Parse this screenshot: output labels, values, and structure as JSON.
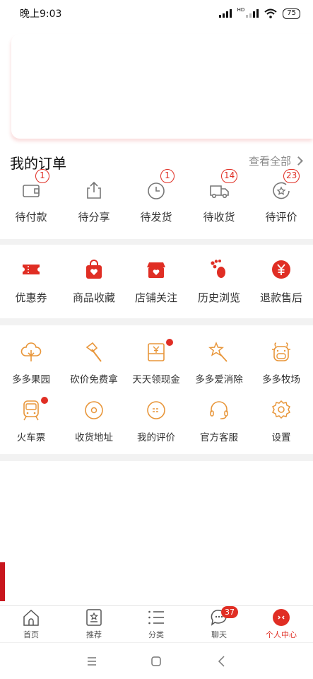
{
  "status_bar": {
    "time": "晚上9:03",
    "battery": "75",
    "network_tag": "HD"
  },
  "orders": {
    "title": "我的订单",
    "view_all": "查看全部",
    "items": [
      {
        "label": "待付款",
        "badge": "1",
        "icon": "wallet-icon"
      },
      {
        "label": "待分享",
        "badge": "",
        "icon": "share-icon"
      },
      {
        "label": "待发货",
        "badge": "1",
        "icon": "clock-icon"
      },
      {
        "label": "待收货",
        "badge": "14",
        "icon": "truck-icon"
      },
      {
        "label": "待评价",
        "badge": "23",
        "icon": "review-icon"
      }
    ]
  },
  "services": {
    "items": [
      {
        "label": "优惠券",
        "icon": "coupon-icon"
      },
      {
        "label": "商品收藏",
        "icon": "favorite-bag-icon"
      },
      {
        "label": "店铺关注",
        "icon": "store-icon"
      },
      {
        "label": "历史浏览",
        "icon": "footprint-icon"
      },
      {
        "label": "退款售后",
        "icon": "refund-icon"
      }
    ]
  },
  "tools": {
    "items": [
      {
        "label": "多多果园",
        "icon": "tree-icon",
        "dot": false
      },
      {
        "label": "砍价免费拿",
        "icon": "axe-icon",
        "dot": false
      },
      {
        "label": "天天领现金",
        "icon": "cash-envelope-icon",
        "dot": true
      },
      {
        "label": "多多爱消除",
        "icon": "star-wand-icon",
        "dot": false
      },
      {
        "label": "多多牧场",
        "icon": "cow-icon",
        "dot": false
      },
      {
        "label": "火车票",
        "icon": "train-icon",
        "dot": true
      },
      {
        "label": "收货地址",
        "icon": "location-icon",
        "dot": false
      },
      {
        "label": "我的评价",
        "icon": "comment-icon",
        "dot": false
      },
      {
        "label": "官方客服",
        "icon": "headset-icon",
        "dot": false
      },
      {
        "label": "设置",
        "icon": "gear-icon",
        "dot": false
      }
    ]
  },
  "tabbar": {
    "items": [
      {
        "label": "首页",
        "icon": "home-icon",
        "badge": ""
      },
      {
        "label": "推荐",
        "icon": "recommend-icon",
        "badge": ""
      },
      {
        "label": "分类",
        "icon": "category-icon",
        "badge": ""
      },
      {
        "label": "聊天",
        "icon": "chat-icon",
        "badge": "37"
      },
      {
        "label": "个人中心",
        "icon": "profile-icon",
        "badge": ""
      }
    ],
    "active_index": 4
  },
  "colors": {
    "accent": "#e02e24",
    "tool_orange": "#e8963a",
    "text": "#333333",
    "muted": "#888888"
  }
}
